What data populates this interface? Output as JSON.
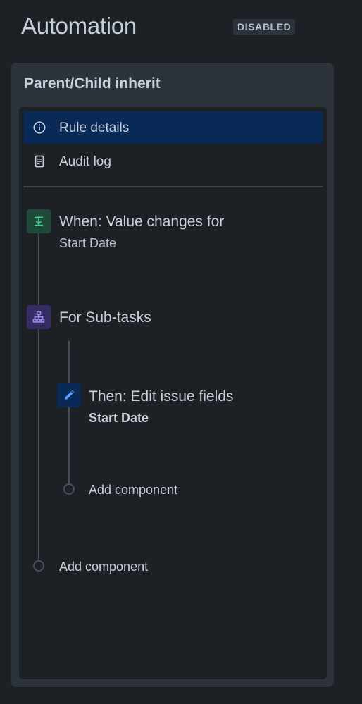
{
  "header": {
    "title": "Automation",
    "status_badge": "DISABLED"
  },
  "rule": {
    "name": "Parent/Child inherit",
    "nav": [
      {
        "label": "Rule details",
        "icon": "info-icon",
        "selected": true
      },
      {
        "label": "Audit log",
        "icon": "audit-log-icon",
        "selected": false
      }
    ],
    "trigger": {
      "title": "When: Value changes for",
      "subtitle": "Start Date",
      "icon": "trigger-icon",
      "color": "#1f845a"
    },
    "branch": {
      "title": "For Sub-tasks",
      "icon": "branch-icon",
      "color": "#8f7ee7",
      "action": {
        "title": "Then: Edit issue fields",
        "subtitle": "Start Date",
        "icon": "pencil-icon",
        "color": "#579dff"
      },
      "add_component_label": "Add component"
    },
    "add_component_label": "Add component"
  }
}
